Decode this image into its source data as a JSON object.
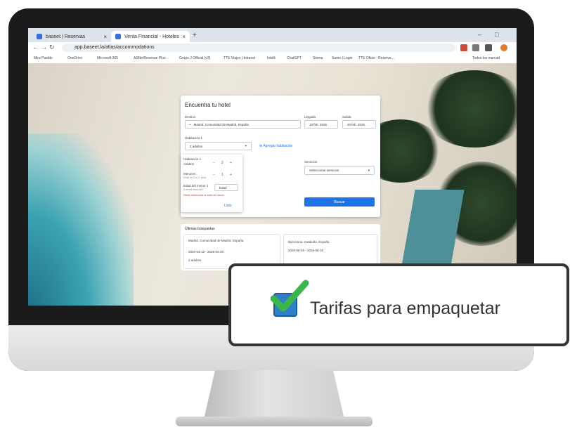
{
  "browser": {
    "tabs": [
      {
        "title": "baseet | Reservas"
      },
      {
        "title": "Venta Financial - Hoteles"
      }
    ],
    "new_tab_symbol": "+",
    "window_controls": [
      "–",
      "□"
    ],
    "url": "app.baseet.la/atlas/accommodations",
    "bookmarks": [
      "Mira Pueblo",
      "OneDrive",
      "Microsoft 365",
      "ASNetRevenue Plus",
      "Grupo J Official (v3)",
      "TTE Viajes | Intranet",
      "Intelli",
      "ChatGPT",
      "Sirena",
      "Sumo | Login",
      "TTE Oficio - Reserve...",
      "Todos los marcad"
    ]
  },
  "search_card": {
    "title": "Encuentra tu hotel",
    "destination_label": "Destino",
    "destination_value": "Madrid, Comunidad de Madrid, España",
    "checkin_label": "Llegada",
    "checkin_value": "13 feb. 2026",
    "checkout_label": "Salida",
    "checkout_value": "20 feb. 2026",
    "room_label": "Habitación 1",
    "room_value": "2 adultos",
    "add_room": "Agregar habitación",
    "services_label": "Servicios",
    "services_value": "Seleccionar servicios",
    "search_button": "Buscar",
    "popup": {
      "room": "Habitación 1",
      "adults_label": "Adultos",
      "adults_value": "2",
      "children_label": "Menores",
      "children_sub": "Edad de 0 a 17 años",
      "children_value": "1",
      "child_age_label": "Edad del menor 1",
      "child_age_sub": "A recibir edad año",
      "child_age_value": "Edad",
      "warning": "Debes seleccionar la edad del menor",
      "done": "Listo"
    }
  },
  "recent_searches": {
    "title": "Últimas búsquedas",
    "items": [
      {
        "place": "Madrid, Comunidad de Madrid, España",
        "dates": "2026-03-13 - 2026-03-20",
        "guests": "2 adultos"
      },
      {
        "place": "Barcelona, Cataluña, España",
        "dates": "2025-08-15 - 2025-08-19"
      }
    ]
  },
  "callout": {
    "label": "Tarifas para empaquetar",
    "checked": true
  },
  "colors": {
    "accent": "#1f73e8",
    "checkbox": "#2f80c9",
    "check": "#3cb54a"
  }
}
